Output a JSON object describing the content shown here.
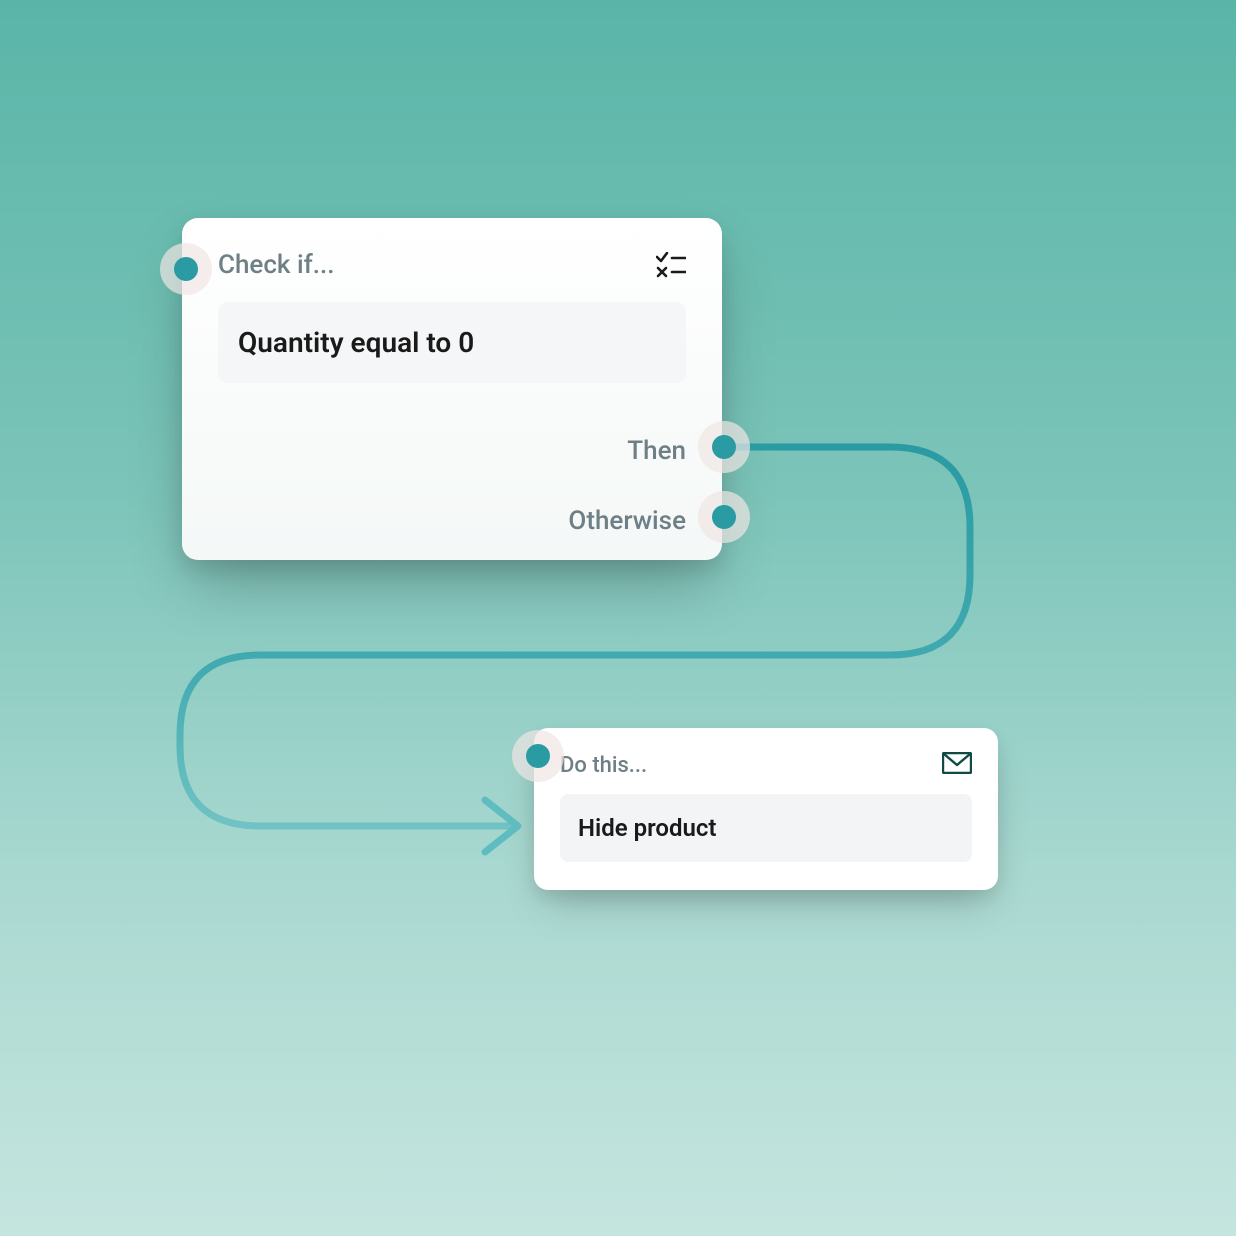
{
  "colors": {
    "accent": "#2a9aa3",
    "text_muted": "#6e7f85",
    "text": "#1a1a1a"
  },
  "condition_node": {
    "title": "Check if...",
    "expression": "Quantity equal to 0",
    "branches": {
      "then": "Then",
      "otherwise": "Otherwise"
    }
  },
  "action_node": {
    "title": "Do this...",
    "action": "Hide product"
  },
  "icons": {
    "condition": "checklist-icon",
    "action": "envelope-icon"
  }
}
